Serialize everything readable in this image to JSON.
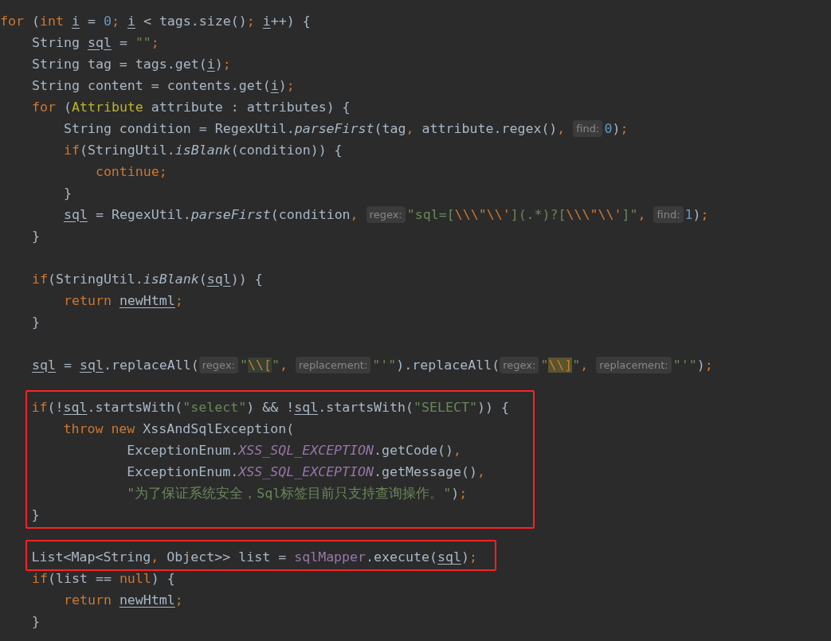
{
  "blocks": [
    {
      "kind": "plain",
      "lines": [
        {
          "kind": "code",
          "tokens": [
            {
              "kind": "k",
              "text": "for"
            },
            {
              "kind": "p",
              "text": " ("
            },
            {
              "kind": "k",
              "text": "int "
            },
            {
              "kind": "u",
              "text": "i"
            },
            {
              "kind": "p",
              "text": " = "
            },
            {
              "kind": "n",
              "text": "0"
            },
            {
              "kind": "k",
              "text": "; "
            },
            {
              "kind": "u",
              "text": "i"
            },
            {
              "kind": "p",
              "text": " < tags.size()"
            },
            {
              "kind": "k",
              "text": "; "
            },
            {
              "kind": "u",
              "text": "i"
            },
            {
              "kind": "p",
              "text": "++) {"
            }
          ]
        },
        {
          "kind": "code",
          "tokens": [
            {
              "kind": "p",
              "text": "    String "
            },
            {
              "kind": "u",
              "text": "sql"
            },
            {
              "kind": "p",
              "text": " = "
            },
            {
              "kind": "s",
              "text": "\"\""
            },
            {
              "kind": "k",
              "text": ";"
            }
          ]
        },
        {
          "kind": "code",
          "tokens": [
            {
              "kind": "p",
              "text": "    String tag = tags.get("
            },
            {
              "kind": "u",
              "text": "i"
            },
            {
              "kind": "p",
              "text": ")"
            },
            {
              "kind": "k",
              "text": ";"
            }
          ]
        },
        {
          "kind": "code",
          "tokens": [
            {
              "kind": "p",
              "text": "    String content = contents.get("
            },
            {
              "kind": "u",
              "text": "i"
            },
            {
              "kind": "p",
              "text": ")"
            },
            {
              "kind": "k",
              "text": ";"
            }
          ]
        },
        {
          "kind": "code",
          "tokens": [
            {
              "kind": "k",
              "text": "    for"
            },
            {
              "kind": "p",
              "text": " ("
            },
            {
              "kind": "t",
              "text": "Attribute"
            },
            {
              "kind": "p",
              "text": " attribute : attributes) {"
            }
          ]
        },
        {
          "kind": "code",
          "tokens": [
            {
              "kind": "p",
              "text": "        String condition = RegexUtil."
            },
            {
              "kind": "m",
              "text": "parseFirst"
            },
            {
              "kind": "p",
              "text": "(tag"
            },
            {
              "kind": "k",
              "text": ","
            },
            {
              "kind": "p",
              "text": " attribute.regex()"
            },
            {
              "kind": "k",
              "text": ", "
            },
            {
              "kind": "hint",
              "text": "find:"
            },
            {
              "kind": "n",
              "text": "0"
            },
            {
              "kind": "p",
              "text": ")"
            },
            {
              "kind": "k",
              "text": ";"
            }
          ]
        },
        {
          "kind": "code",
          "tokens": [
            {
              "kind": "k",
              "text": "        if"
            },
            {
              "kind": "p",
              "text": "(StringUtil."
            },
            {
              "kind": "m",
              "text": "isBlank"
            },
            {
              "kind": "p",
              "text": "(condition)) {"
            }
          ]
        },
        {
          "kind": "code",
          "tokens": [
            {
              "kind": "k",
              "text": "            continue;"
            }
          ]
        },
        {
          "kind": "code",
          "tokens": [
            {
              "kind": "p",
              "text": "        }"
            }
          ]
        },
        {
          "kind": "code",
          "tokens": [
            {
              "kind": "u",
              "text": "        sql"
            },
            {
              "kind": "p",
              "text": " = RegexUtil."
            },
            {
              "kind": "m",
              "text": "parseFirst"
            },
            {
              "kind": "p",
              "text": "(condition"
            },
            {
              "kind": "k",
              "text": ", "
            },
            {
              "kind": "hint",
              "text": "regex:"
            },
            {
              "kind": "s",
              "text": "\"sql=["
            },
            {
              "kind": "e",
              "text": "\\\\\\\"\\\\'"
            },
            {
              "kind": "s",
              "text": "](.*)?["
            },
            {
              "kind": "e",
              "text": "\\\\\\\"\\\\'"
            },
            {
              "kind": "s",
              "text": "]\""
            },
            {
              "kind": "k",
              "text": ", "
            },
            {
              "kind": "hint",
              "text": "find:"
            },
            {
              "kind": "n",
              "text": "1"
            },
            {
              "kind": "p",
              "text": ")"
            },
            {
              "kind": "k",
              "text": ";"
            }
          ]
        },
        {
          "kind": "code",
          "tokens": [
            {
              "kind": "p",
              "text": "    }"
            }
          ]
        },
        {
          "kind": "blank"
        },
        {
          "kind": "code",
          "tokens": [
            {
              "kind": "k",
              "text": "    if"
            },
            {
              "kind": "p",
              "text": "(StringUtil."
            },
            {
              "kind": "m",
              "text": "isBlank"
            },
            {
              "kind": "p",
              "text": "("
            },
            {
              "kind": "u",
              "text": "sql"
            },
            {
              "kind": "p",
              "text": ")) {"
            }
          ]
        },
        {
          "kind": "code",
          "tokens": [
            {
              "kind": "k",
              "text": "        return "
            },
            {
              "kind": "u",
              "text": "newHtml"
            },
            {
              "kind": "k",
              "text": ";"
            }
          ]
        },
        {
          "kind": "code",
          "tokens": [
            {
              "kind": "p",
              "text": "    }"
            }
          ]
        },
        {
          "kind": "blank"
        },
        {
          "kind": "code",
          "tokens": [
            {
              "kind": "u",
              "text": "    sql"
            },
            {
              "kind": "p",
              "text": " = "
            },
            {
              "kind": "u",
              "text": "sql"
            },
            {
              "kind": "p",
              "text": ".replaceAll("
            },
            {
              "kind": "hint",
              "text": "regex:"
            },
            {
              "kind": "s",
              "text": "\""
            },
            {
              "kind": "eg",
              "text": "\\\\["
            },
            {
              "kind": "s",
              "text": "\""
            },
            {
              "kind": "k",
              "text": ", "
            },
            {
              "kind": "hint",
              "text": "replacement:"
            },
            {
              "kind": "s",
              "text": "\"'\""
            },
            {
              "kind": "p",
              "text": ").replaceAll("
            },
            {
              "kind": "hint",
              "text": "regex:"
            },
            {
              "kind": "s",
              "text": "\""
            },
            {
              "kind": "eo",
              "text": "\\\\]"
            },
            {
              "kind": "s",
              "text": "\""
            },
            {
              "kind": "k",
              "text": ", "
            },
            {
              "kind": "hint",
              "text": "replacement:"
            },
            {
              "kind": "s",
              "text": "\"'\""
            },
            {
              "kind": "p",
              "text": ")"
            },
            {
              "kind": "k",
              "text": ";"
            }
          ]
        },
        {
          "kind": "blank"
        }
      ]
    },
    {
      "kind": "frame",
      "lines": [
        {
          "kind": "code",
          "tokens": [
            {
              "kind": "k",
              "text": "    if"
            },
            {
              "kind": "p",
              "text": "(!"
            },
            {
              "kind": "u",
              "text": "sql"
            },
            {
              "kind": "p",
              "text": ".startsWith("
            },
            {
              "kind": "s",
              "text": "\"select\""
            },
            {
              "kind": "p",
              "text": ") && !"
            },
            {
              "kind": "u",
              "text": "sql"
            },
            {
              "kind": "p",
              "text": ".startsWith("
            },
            {
              "kind": "s",
              "text": "\"SELECT\""
            },
            {
              "kind": "p",
              "text": ")) {"
            }
          ]
        },
        {
          "kind": "code",
          "tokens": [
            {
              "kind": "k",
              "text": "        throw new"
            },
            {
              "kind": "p",
              "text": " XssAndSqlException("
            }
          ]
        },
        {
          "kind": "code",
          "tokens": [
            {
              "kind": "p",
              "text": "                ExceptionEnum."
            },
            {
              "kind": "f",
              "text": "XSS_SQL_EXCEPTION"
            },
            {
              "kind": "p",
              "text": ".getCode()"
            },
            {
              "kind": "k",
              "text": ","
            }
          ]
        },
        {
          "kind": "code",
          "tokens": [
            {
              "kind": "p",
              "text": "                ExceptionEnum."
            },
            {
              "kind": "f",
              "text": "XSS_SQL_EXCEPTION"
            },
            {
              "kind": "p",
              "text": ".getMessage()"
            },
            {
              "kind": "k",
              "text": ","
            }
          ]
        },
        {
          "kind": "code",
          "tokens": [
            {
              "kind": "s",
              "text": "                \"为了保证系统安全，Sql标签目前只支持查询操作。\""
            },
            {
              "kind": "p",
              "text": ")"
            },
            {
              "kind": "k",
              "text": ";"
            }
          ]
        },
        {
          "kind": "code",
          "tokens": [
            {
              "kind": "p",
              "text": "    }"
            }
          ]
        }
      ]
    },
    {
      "kind": "plain",
      "lines": [
        {
          "kind": "blank"
        }
      ]
    },
    {
      "kind": "frame",
      "lines": [
        {
          "kind": "code",
          "tokens": [
            {
              "kind": "p",
              "text": "    List<Map<String"
            },
            {
              "kind": "k",
              "text": ","
            },
            {
              "kind": "p",
              "text": " Object>> list = "
            },
            {
              "kind": "v",
              "text": "sqlMapper"
            },
            {
              "kind": "p",
              "text": ".execute("
            },
            {
              "kind": "u",
              "text": "sql"
            },
            {
              "kind": "p",
              "text": ")"
            },
            {
              "kind": "k",
              "text": ";"
            }
          ]
        }
      ]
    },
    {
      "kind": "plain",
      "lines": [
        {
          "kind": "code",
          "tokens": [
            {
              "kind": "k",
              "text": "    if"
            },
            {
              "kind": "p",
              "text": "(list == "
            },
            {
              "kind": "k",
              "text": "null"
            },
            {
              "kind": "p",
              "text": ") {"
            }
          ]
        },
        {
          "kind": "code",
          "tokens": [
            {
              "kind": "k",
              "text": "        return "
            },
            {
              "kind": "u",
              "text": "newHtml"
            },
            {
              "kind": "k",
              "text": ";"
            }
          ]
        },
        {
          "kind": "code",
          "tokens": [
            {
              "kind": "p",
              "text": "    }"
            }
          ]
        }
      ]
    }
  ]
}
